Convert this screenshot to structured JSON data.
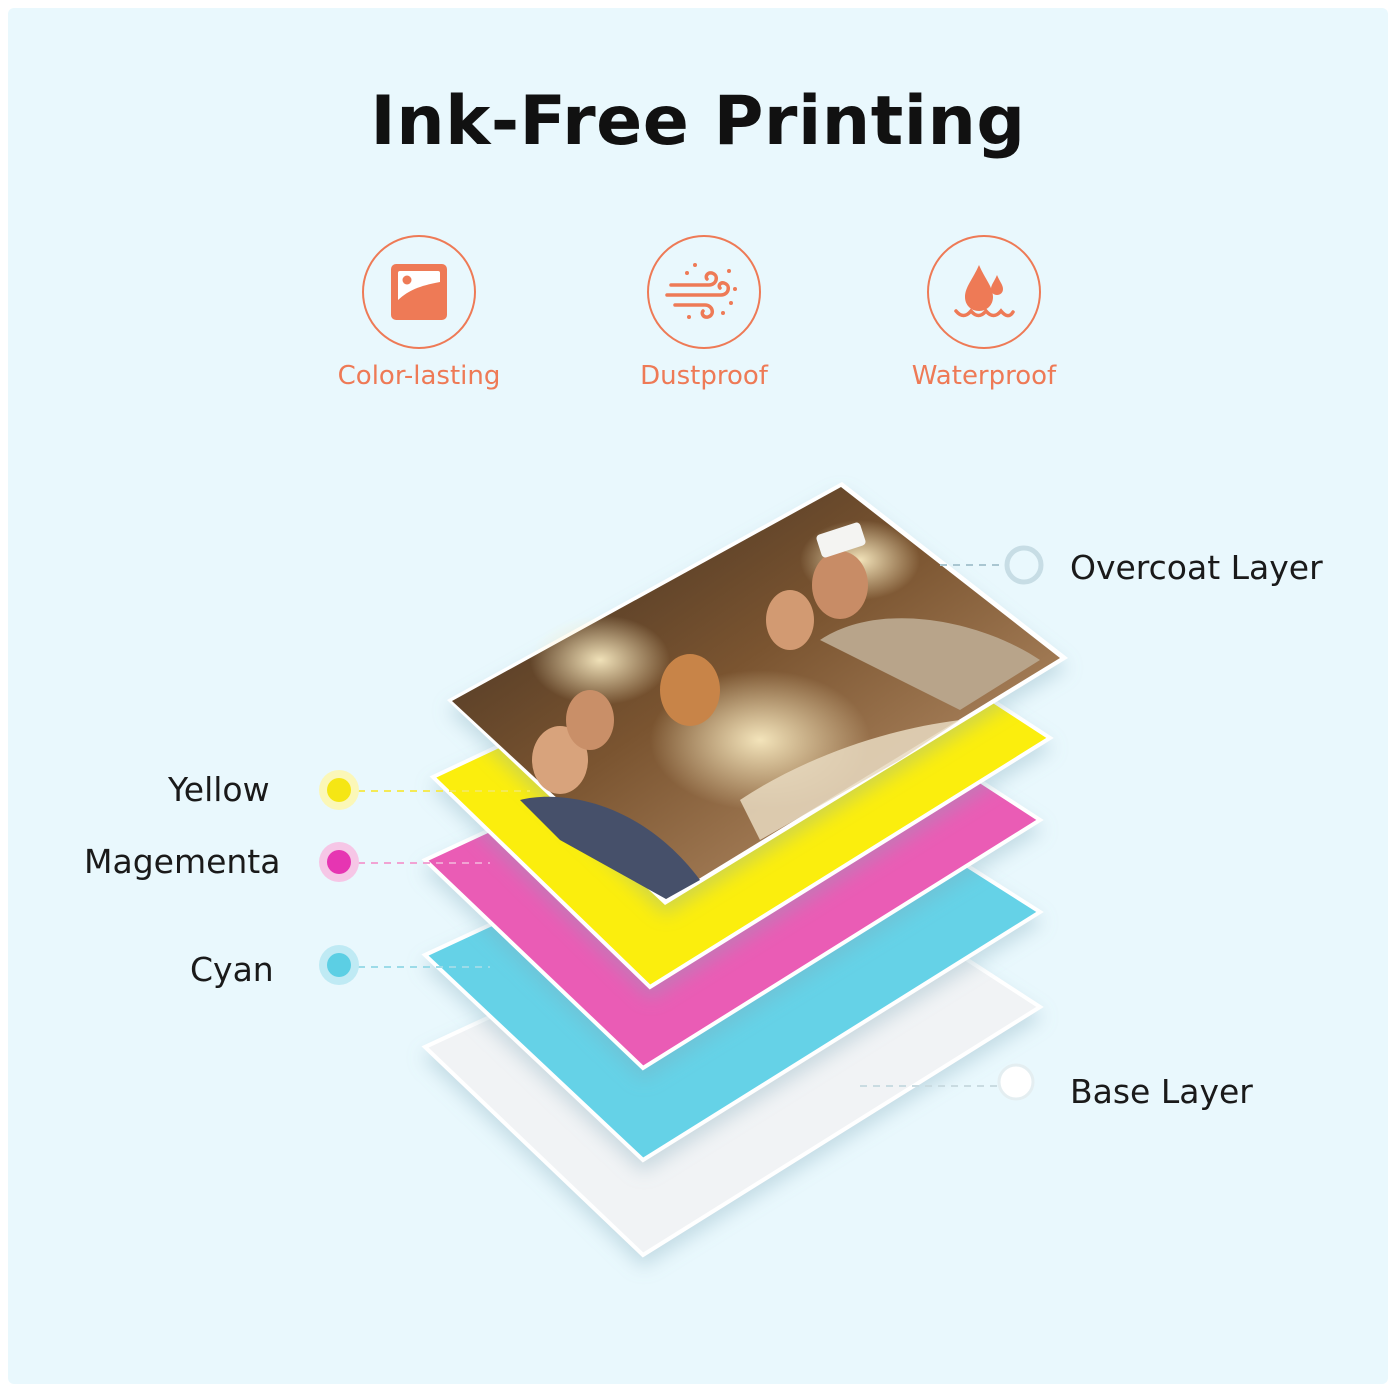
{
  "title": "Ink-Free Printing",
  "features": [
    {
      "label": "Color-lasting",
      "icon": "photo-icon"
    },
    {
      "label": "Dustproof",
      "icon": "wind-dust-icon"
    },
    {
      "label": "Waterproof",
      "icon": "water-drop-icon"
    }
  ],
  "layers": {
    "overcoat": "Overcoat Layer",
    "yellow": "Yellow",
    "magenta": "Magementa",
    "cyan": "Cyan",
    "base": "Base Layer"
  },
  "colors": {
    "accent": "#ee7a56",
    "background": "#e9f8fd",
    "yellow": "#fbee08",
    "magenta": "#ea5cb5",
    "cyan": "#65d2e7",
    "base": "#f1f3f5"
  }
}
